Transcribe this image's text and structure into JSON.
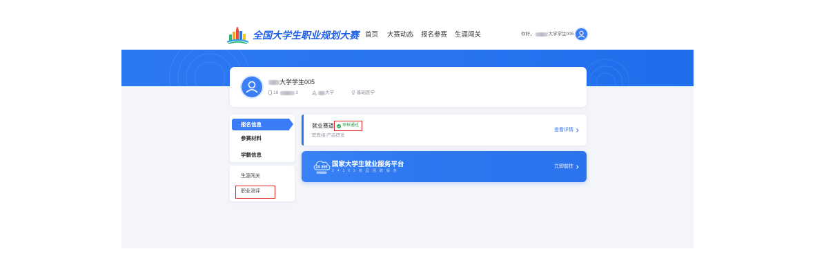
{
  "header": {
    "brand_title": "全国大学生职业规划大赛",
    "logo_icon": "colorful-bars-logo",
    "nav": [
      {
        "label": "首页"
      },
      {
        "label": "大赛动态"
      },
      {
        "label": "报名参赛"
      },
      {
        "label": "生涯闯关"
      }
    ],
    "greeting": "你好，",
    "user_name_visible": "大学学生005",
    "avatar_icon": "user-icon"
  },
  "profile": {
    "avatar_icon": "user-icon",
    "name_visible": "大学学生005",
    "phone_icon": "phone-icon",
    "phone_start": "18",
    "phone_end": "3",
    "school_icon": "school-icon",
    "school_visible": "大学",
    "major_icon": "major-icon",
    "major": "基础医学"
  },
  "sidebar": {
    "primary_items": [
      {
        "label": "报名信息",
        "active": true
      },
      {
        "label": "参赛材料",
        "active": false
      },
      {
        "label": "学籍信息",
        "active": false
      }
    ],
    "secondary_items": [
      {
        "label": "生涯闯关",
        "highlighted": false
      },
      {
        "label": "职业测评",
        "highlighted": true
      }
    ]
  },
  "track_card": {
    "title": "就业赛道",
    "status": "审核通过",
    "status_icon": "check-circle-icon",
    "status_highlighted": true,
    "subtitle": "职教组-产品研发",
    "detail_link": "查看详情",
    "detail_icon": "chevron-right-icon"
  },
  "platform_banner": {
    "logo_text": "24 365",
    "title": "国家大学生就业服务平台",
    "subtitle": "24365校园招聘服务",
    "cta": "立即前往",
    "cta_icon": "chevron-right-icon"
  },
  "colors": {
    "brand_blue": "#2f74f0",
    "band_blue": "#2a74f1",
    "status_green": "#2ea44f",
    "highlight_red": "#e02020",
    "page_gray": "#f3f5f9",
    "title_blue": "#1d5fe6"
  }
}
